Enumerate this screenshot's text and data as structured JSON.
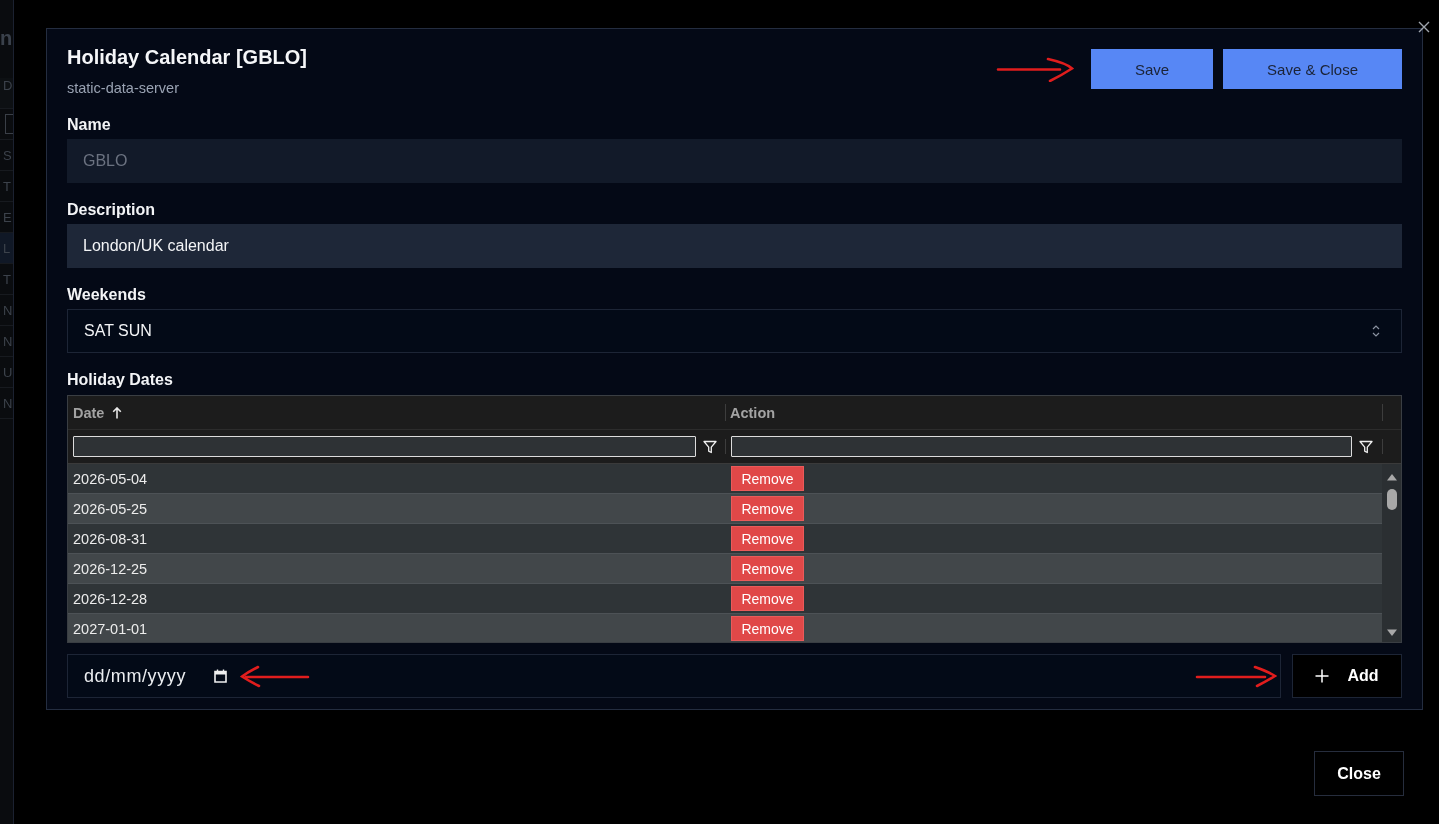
{
  "background_page": {
    "title": "n",
    "rows": [
      {
        "kind": "header",
        "text": "D",
        "selected": false
      },
      {
        "kind": "filter",
        "selected": false
      },
      {
        "kind": "row",
        "text": "S",
        "selected": false
      },
      {
        "kind": "row",
        "text": "T",
        "selected": false
      },
      {
        "kind": "row",
        "text": "E",
        "selected": false
      },
      {
        "kind": "row",
        "text": "L",
        "selected": true
      },
      {
        "kind": "row",
        "text": "T",
        "selected": false
      },
      {
        "kind": "row",
        "text": "N",
        "selected": false
      },
      {
        "kind": "row",
        "text": "N",
        "selected": false
      },
      {
        "kind": "row",
        "text": "U",
        "selected": false
      },
      {
        "kind": "row",
        "text": "N",
        "selected": false
      }
    ]
  },
  "modal": {
    "title": "Holiday Calendar [GBLO]",
    "subtitle": "static-data-server",
    "buttons": [
      {
        "label": "Save"
      },
      {
        "label": "Save & Close"
      }
    ],
    "fields": [
      {
        "kind": "text",
        "label": "Name",
        "value": "GBLO",
        "disabled": true
      },
      {
        "kind": "text",
        "label": "Description",
        "value": "London/UK calendar",
        "disabled": false
      },
      {
        "kind": "select",
        "label": "Weekends",
        "value": "SAT SUN"
      }
    ],
    "holiday_dates": {
      "label": "Holiday Dates",
      "columns": [
        {
          "label": "Date",
          "sorted": true
        },
        {
          "label": "Action",
          "sorted": false
        }
      ],
      "rows": [
        {
          "date": "2026-05-04",
          "action": "Remove"
        },
        {
          "date": "2026-05-25",
          "action": "Remove"
        },
        {
          "date": "2026-08-31",
          "action": "Remove"
        },
        {
          "date": "2026-12-25",
          "action": "Remove"
        },
        {
          "date": "2026-12-28",
          "action": "Remove"
        },
        {
          "date": "2027-01-01",
          "action": "Remove"
        }
      ]
    },
    "new_date": {
      "placeholder": "dd/mm/yyyy"
    },
    "add_button": {
      "label": "Add"
    }
  },
  "close_button": {
    "label": "Close"
  }
}
